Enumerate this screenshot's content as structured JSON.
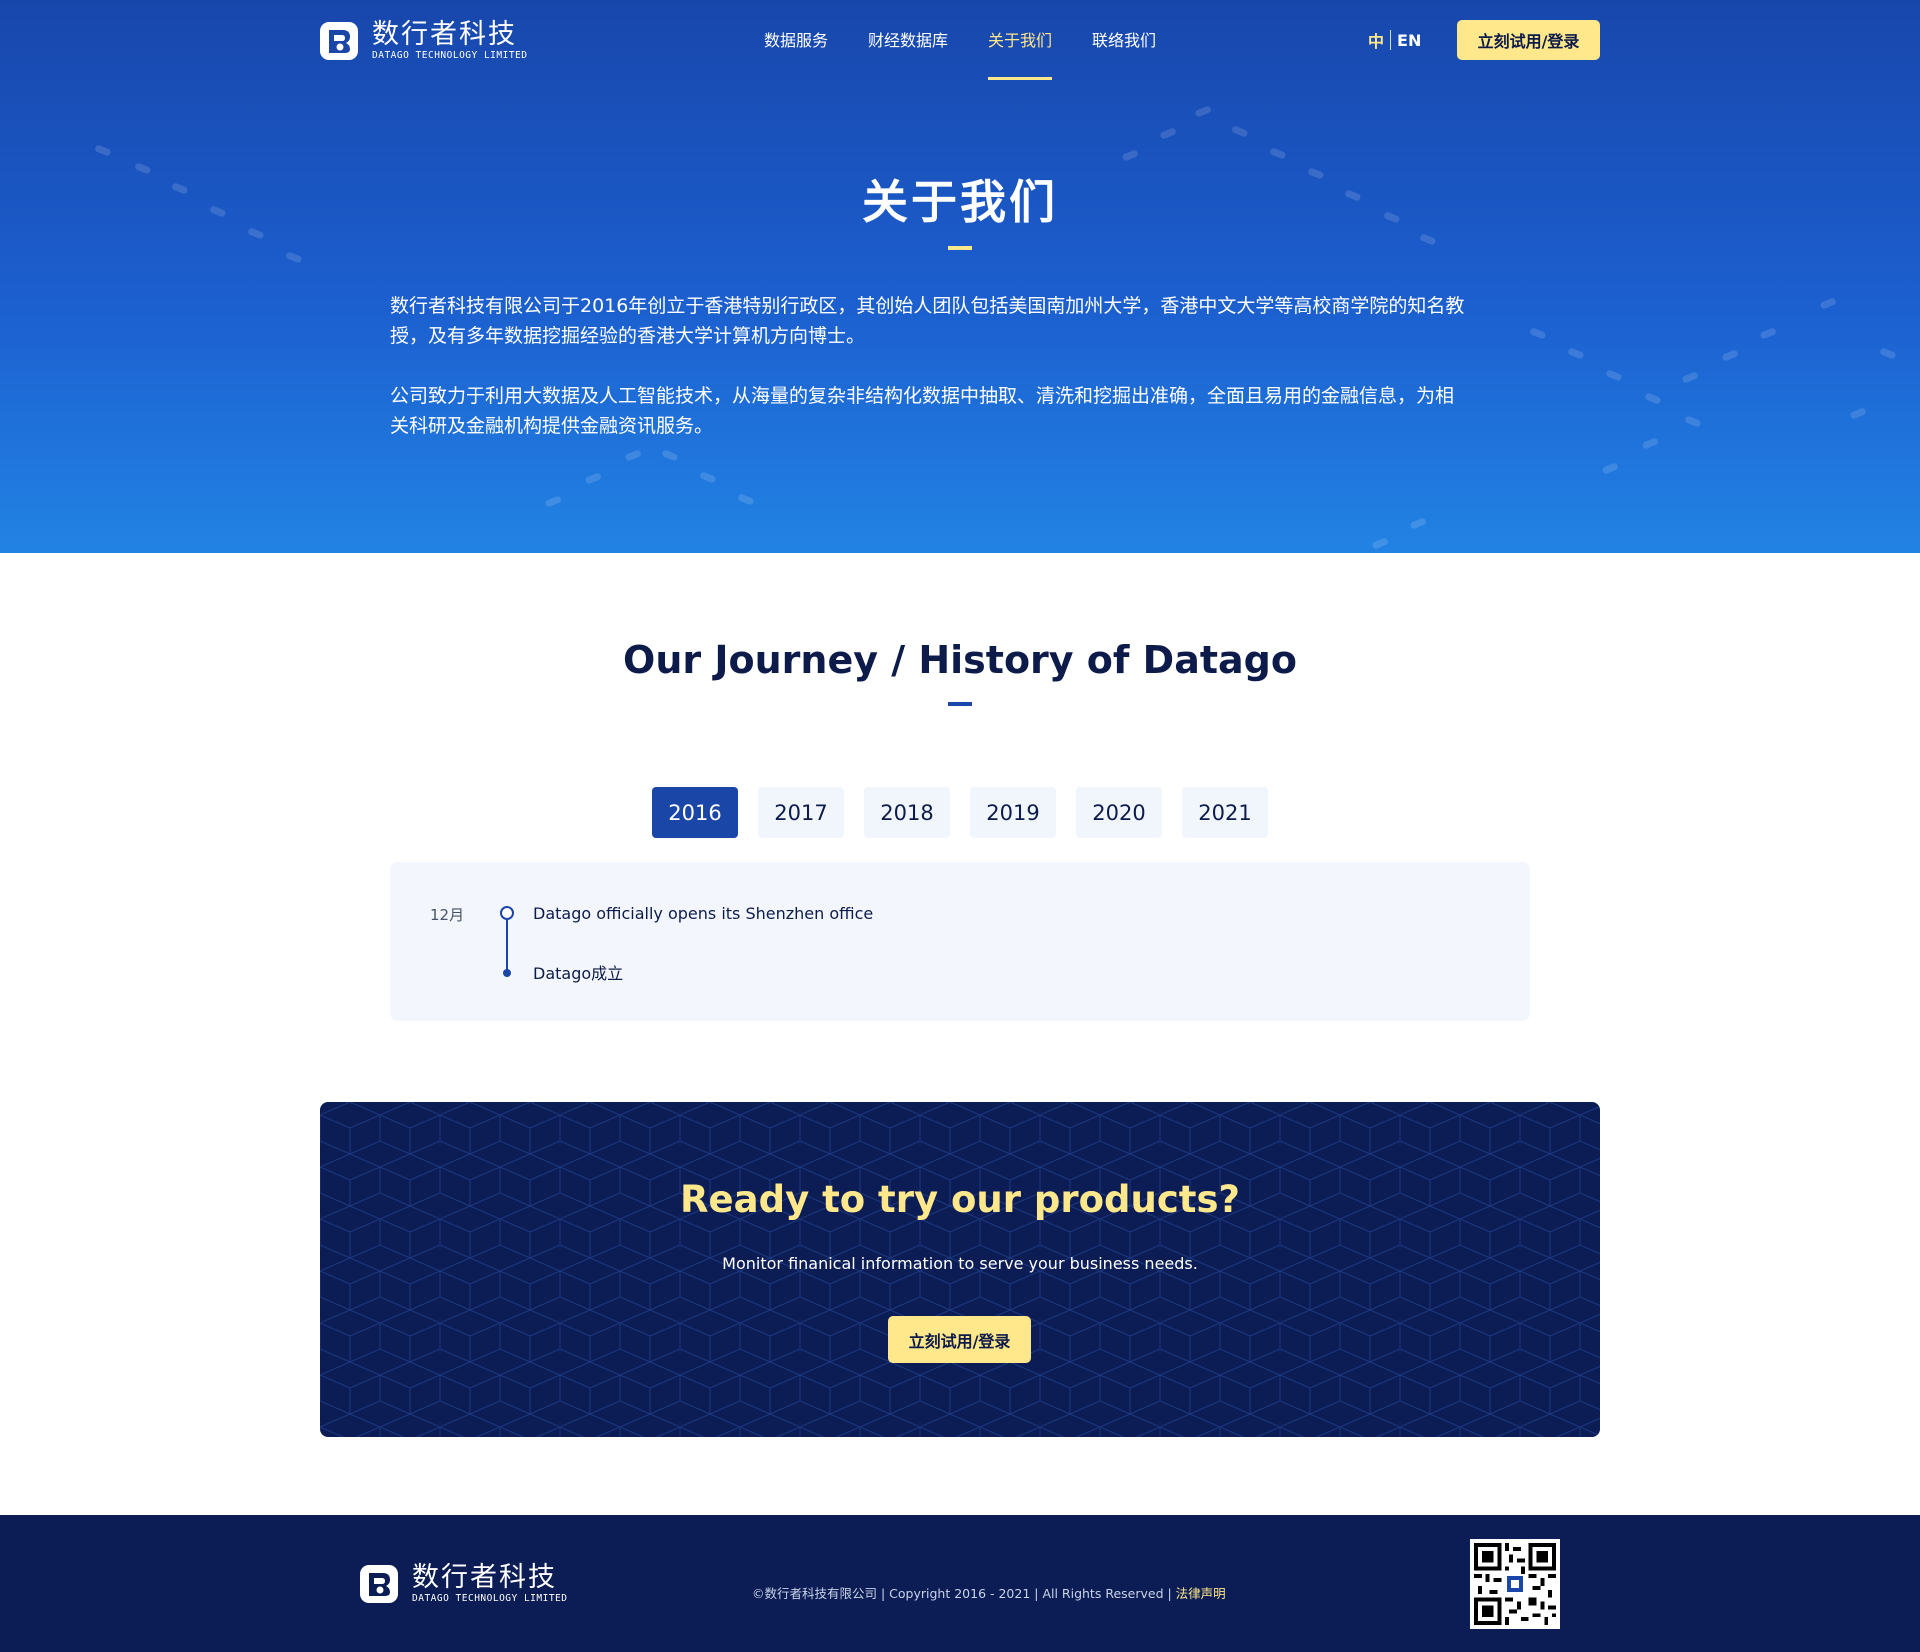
{
  "header": {
    "logo_cn": "数行者科技",
    "logo_en": "DATAGO TECHNOLOGY LIMITED",
    "nav": [
      {
        "label": "数据服务",
        "active": false
      },
      {
        "label": "财经数据库",
        "active": false
      },
      {
        "label": "关于我们",
        "active": true
      },
      {
        "label": "联络我们",
        "active": false
      }
    ],
    "lang_zh": "中",
    "lang_en": "EN",
    "cta_label": "立刻试用/登录"
  },
  "hero": {
    "title": "关于我们",
    "paragraph1_line1": "数行者科技有限公司于2016年创立于香港特别行政区，其创始人团队包括美国南加州大学，香港中文大学等高校商学院的知名教",
    "paragraph1_line2": "授，及有多年数据挖掘经验的香港大学计算机方向博士。",
    "paragraph2_line1": "公司致力于利用大数据及人工智能技术，从海量的复杂非结构化数据中抽取、清洗和挖掘出准确，全面且易用的金融信息，为相",
    "paragraph2_line2": "关科研及金融机构提供金融资讯服务。"
  },
  "journey": {
    "title": "Our Journey / History of Datago",
    "years": [
      "2016",
      "2017",
      "2018",
      "2019",
      "2020",
      "2021"
    ],
    "selected_year": "2016",
    "month": "12月",
    "events": [
      "Datago officially opens its Shenzhen office",
      "Datago成立"
    ]
  },
  "cta": {
    "title": "Ready to try our products?",
    "subtitle": "Monitor finanical information to serve your business needs.",
    "button_label": "立刻试用/登录"
  },
  "footer": {
    "logo_cn": "数行者科技",
    "logo_en": "DATAGO TECHNOLOGY LIMITED",
    "copyright": "©数行者科技有限公司 | Copyright 2016 - 2021 | All Rights Reserved | ",
    "legal_label": "法律声明"
  },
  "colors": {
    "brand_blue": "#1a46a8",
    "accent_yellow": "#ffe78b",
    "navy": "#0b1d54"
  }
}
